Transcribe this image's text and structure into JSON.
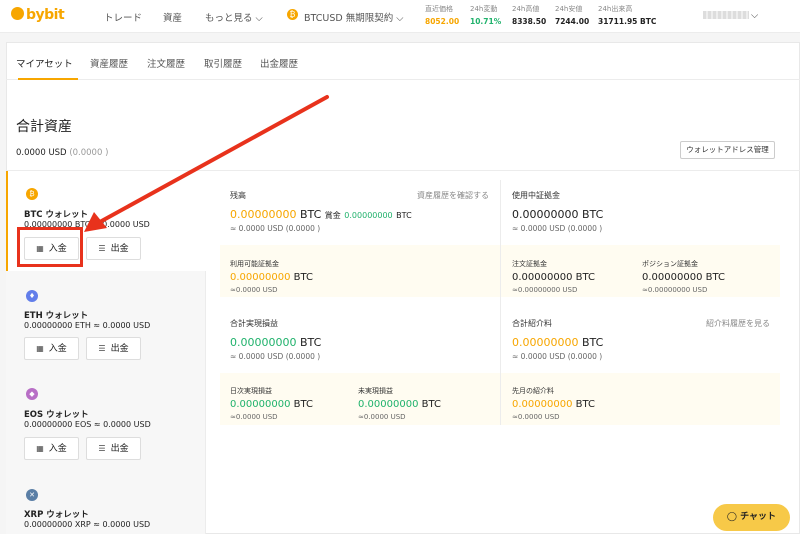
{
  "header": {
    "logo": "bybit",
    "nav": [
      "トレード",
      "資産",
      "もっと見る"
    ],
    "contract": "BTCUSD 無期限契約",
    "tickers": [
      {
        "label": "直近価格",
        "value": "8052.00",
        "color": "#f7a600"
      },
      {
        "label": "24h変動",
        "value": "10.71%",
        "color": "#20b26c"
      },
      {
        "label": "24h高値",
        "value": "8338.50",
        "color": "#222222"
      },
      {
        "label": "24h安値",
        "value": "7244.00",
        "color": "#222222"
      },
      {
        "label": "24h出来高",
        "value": "31711.95 BTC",
        "color": "#222222"
      }
    ]
  },
  "tabs": [
    "マイアセット",
    "資産履歴",
    "注文履歴",
    "取引履歴",
    "出金履歴"
  ],
  "summary": {
    "title": "合計資産",
    "total": "0.0000 USD",
    "total_paren": "(0.0000 )",
    "address_btn": "ウォレットアドレス管理"
  },
  "wallets": [
    {
      "name": "BTC ウォレット",
      "balance": "0.00000000 BTC ≈ 0.0000 USD",
      "color": "#f7a600",
      "glyph": "₿"
    },
    {
      "name": "ETH ウォレット",
      "balance": "0.00000000 ETH ≈ 0.0000 USD",
      "color": "#627eea",
      "glyph": "♦"
    },
    {
      "name": "EOS ウォレット",
      "balance": "0.00000000 EOS ≈ 0.0000 USD",
      "color": "#b86fc6",
      "glyph": "◆"
    },
    {
      "name": "XRP ウォレット",
      "balance": "0.00000000 XRP ≈ 0.0000 USD",
      "color": "#5b7fa6",
      "glyph": "✕"
    }
  ],
  "buttons": {
    "deposit": "入金",
    "withdraw": "出金"
  },
  "details": {
    "balance_label": "残高",
    "balance_num": "0.00000000",
    "balance_unit": "BTC",
    "bonus_label": "賞金",
    "bonus_num": "0.00000000",
    "bonus_unit": "BTC",
    "balance_usd": "≈ 0.0000 USD (0.0000 )",
    "history_link": "資産履歴を確認する",
    "margin_label": "使用中証拠金",
    "margin_val": "0.00000000 BTC",
    "margin_usd": "≈ 0.0000 USD (0.0000 )",
    "avail_label": "利用可能証拠金",
    "avail_num": "0.00000000",
    "avail_unit": "BTC",
    "avail_usd": "≈0.0000 USD",
    "order_label": "注文証拠金",
    "order_val": "0.00000000 BTC",
    "order_usd": "≈0.00000000 USD",
    "pos_label": "ポジション証拠金",
    "pos_val": "0.00000000 BTC",
    "pos_usd": "≈0.00000000 USD",
    "realized_label": "合計実現損益",
    "realized_num": "0.00000000",
    "realized_unit": "BTC",
    "realized_usd": "≈ 0.0000 USD (0.0000 )",
    "ref_label": "合計紹介料",
    "ref_num": "0.00000000",
    "ref_unit": "BTC",
    "ref_usd": "≈ 0.0000 USD (0.0000 )",
    "ref_link": "紹介料履歴を見る",
    "daily_label": "日次実現損益",
    "daily_num": "0.00000000",
    "daily_unit": "BTC",
    "daily_usd": "≈0.0000 USD",
    "unreal_label": "未実現損益",
    "unreal_num": "0.00000000",
    "unreal_unit": "BTC",
    "unreal_usd": "≈0.0000 USD",
    "prev_label": "先月の紹介料",
    "prev_num": "0.00000000",
    "prev_unit": "BTC",
    "prev_usd": "≈0.0000 USD"
  },
  "chat": "チャット"
}
